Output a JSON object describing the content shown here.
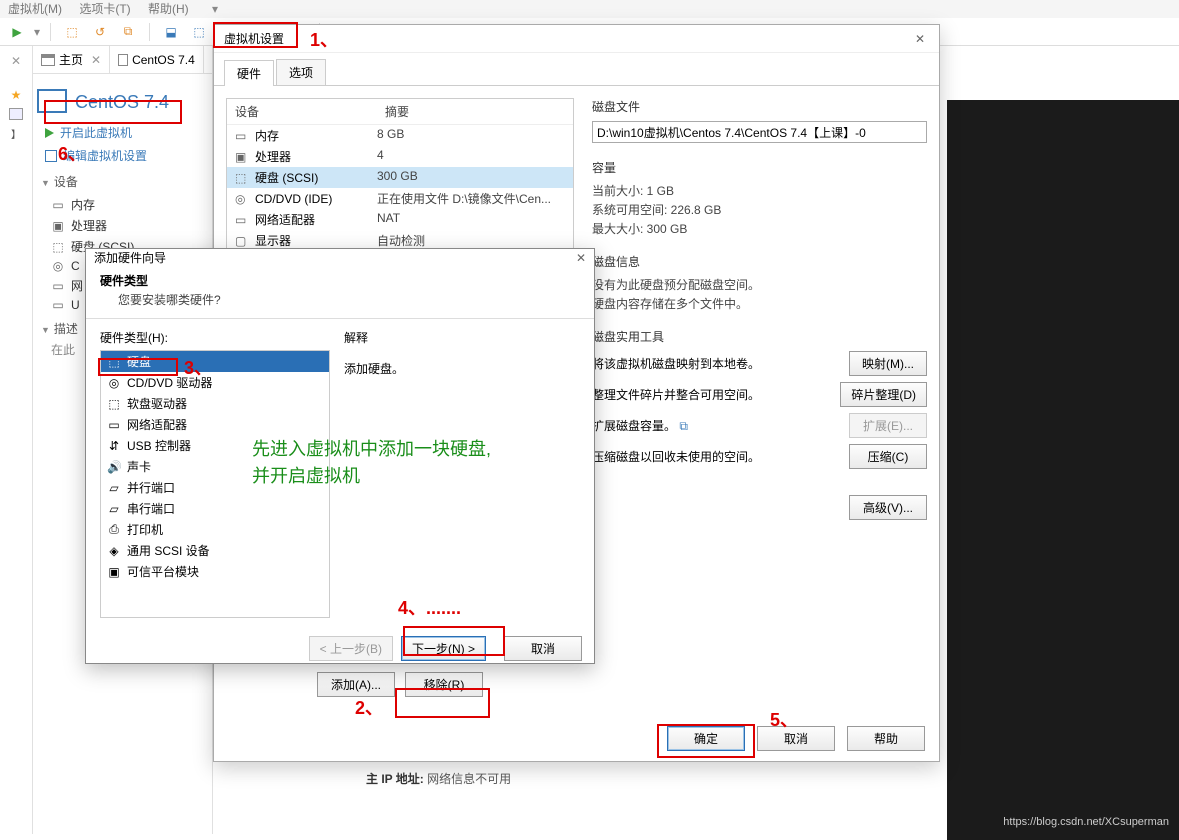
{
  "menubar": {
    "vm": "虚拟机(M)",
    "tabs": "选项卡(T)",
    "help": "帮助(H)"
  },
  "tabs": {
    "home": "主页",
    "vm": "CentOS 7.4"
  },
  "vm_title": "CentOS 7.4",
  "sidebar_actions": {
    "power_on": "开启此虚拟机",
    "edit": "编辑虚拟机设置"
  },
  "sect": {
    "devices": "设备",
    "desc": "描述"
  },
  "desc_placeholder": "在此",
  "dev_sidebar": [
    {
      "g": "▭",
      "n": "内存"
    },
    {
      "g": "▣",
      "n": "处理器"
    },
    {
      "g": "⬚",
      "n": "硬盘 (SCSI)"
    },
    {
      "g": "◎",
      "n": "C"
    },
    {
      "g": "▭",
      "n": "网"
    },
    {
      "g": "▭",
      "n": "U"
    }
  ],
  "settings": {
    "title": "虚拟机设置",
    "tabs": {
      "hw": "硬件",
      "opt": "选项"
    },
    "cols": {
      "device": "设备",
      "summary": "摘要"
    },
    "rows": [
      {
        "g": "▭",
        "n": "内存",
        "s": "8 GB"
      },
      {
        "g": "▣",
        "n": "处理器",
        "s": "4"
      },
      {
        "g": "⬚",
        "n": "硬盘 (SCSI)",
        "s": "300 GB",
        "sel": true
      },
      {
        "g": "◎",
        "n": "CD/DVD (IDE)",
        "s": "正在使用文件 D:\\镜像文件\\Cen..."
      },
      {
        "g": "▭",
        "n": "网络适配器",
        "s": "NAT"
      },
      {
        "g": "▢",
        "n": "显示器",
        "s": "自动检测"
      }
    ],
    "add": "添加(A)...",
    "remove": "移除(R)",
    "ok": "确定",
    "cancel": "取消",
    "help": "帮助"
  },
  "right": {
    "disk_file": "磁盘文件",
    "path": "D:\\win10虚拟机\\Centos 7.4\\CentOS 7.4【上课】-0",
    "capacity": "容量",
    "cur": "当前大小: 1 GB",
    "free": "系统可用空间: 226.8 GB",
    "max": "最大大小: 300 GB",
    "info": "磁盘信息",
    "info1": "没有为此硬盘预分配磁盘空间。",
    "info2": "硬盘内容存储在多个文件中。",
    "util": "磁盘实用工具",
    "map_t": "将该虚拟机磁盘映射到本地卷。",
    "map_b": "映射(M)...",
    "defrag_t": "整理文件碎片并整合可用空间。",
    "defrag_b": "碎片整理(D)",
    "expand_t": "扩展磁盘容量。",
    "expand_b": "扩展(E)...",
    "compact_t": "压缩磁盘以回收未使用的空间。",
    "compact_b": "压缩(C)",
    "adv": "高级(V)..."
  },
  "wizard": {
    "title": "添加硬件向导",
    "h1": "硬件类型",
    "h2": "您要安装哪类硬件?",
    "list_label": "硬件类型(H):",
    "items": [
      {
        "g": "⬚",
        "n": "硬盘",
        "sel": true
      },
      {
        "g": "◎",
        "n": "CD/DVD 驱动器"
      },
      {
        "g": "⬚",
        "n": "软盘驱动器"
      },
      {
        "g": "▭",
        "n": "网络适配器"
      },
      {
        "g": "⇵",
        "n": "USB 控制器"
      },
      {
        "g": "🔊",
        "n": "声卡"
      },
      {
        "g": "▱",
        "n": "并行端口"
      },
      {
        "g": "▱",
        "n": "串行端口"
      },
      {
        "g": "⎙",
        "n": "打印机"
      },
      {
        "g": "◈",
        "n": "通用 SCSI 设备"
      },
      {
        "g": "▣",
        "n": "可信平台模块"
      }
    ],
    "desc_label": "解释",
    "desc": "添加硬盘。",
    "back": "< 上一步(B)",
    "next": "下一步(N) >",
    "cancel": "取消"
  },
  "footer": {
    "label": "主 IP 地址:",
    "val": "网络信息不可用"
  },
  "annots": {
    "a1": "1、",
    "a2": "2、",
    "a3": "3、",
    "a4": "4、.......",
    "a5": "5、",
    "a6": "6、",
    "green": "先进入虚拟机中添加一块硬盘,\n并开启虚拟机"
  },
  "watermark": "https://blog.csdn.net/XCsuperman"
}
